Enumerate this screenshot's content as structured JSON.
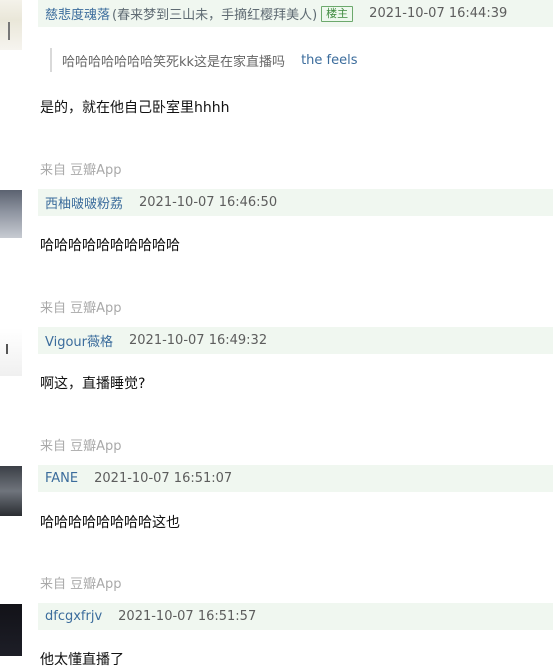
{
  "comments": [
    {
      "author": "慈悲度魂落",
      "signature": "(春来梦到三山未，手摘红樱拜美人)",
      "badge": "楼主",
      "timestamp": "2021-10-07 16:44:39",
      "quote": {
        "text": "哈哈哈哈哈哈哈笑死kk这是在家直播吗",
        "author": "the feels"
      },
      "text": "是的，就在他自己卧室里hhhh",
      "source": "来自 豆瓣App"
    },
    {
      "author": "西柚啵啵粉荔",
      "timestamp": "2021-10-07 16:46:50",
      "text": "哈哈哈哈哈哈哈哈哈哈",
      "source": "来自 豆瓣App"
    },
    {
      "author": "Vigour薇格",
      "timestamp": "2021-10-07 16:49:32",
      "text": "啊这，直播睡觉?",
      "source": "来自 豆瓣App"
    },
    {
      "author": "FANE",
      "timestamp": "2021-10-07 16:51:07",
      "text": "哈哈哈哈哈哈哈哈这也",
      "source": "来自 豆瓣App"
    },
    {
      "author": "dfcgxfrjv",
      "timestamp": "2021-10-07 16:51:57",
      "text": "他太懂直播了"
    }
  ],
  "colors": {
    "author_link": "#3b6c9c",
    "header_bg": "#f0f7f0",
    "op_badge": "#3f8a3f",
    "source_text": "#a9a9a9"
  },
  "icons": [
    "user-avatar"
  ]
}
